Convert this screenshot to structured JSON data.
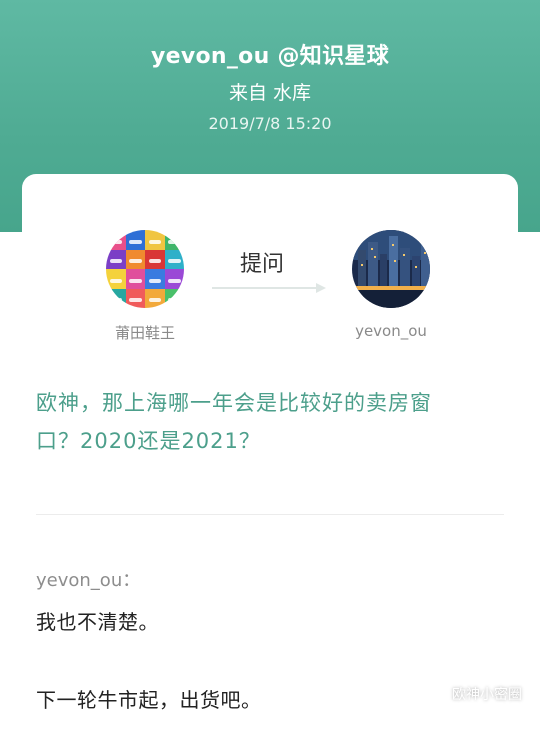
{
  "header": {
    "title": "yevon_ou @知识星球",
    "source": "来自 水库",
    "timestamp": "2019/7/8 15:20"
  },
  "card": {
    "asker": {
      "name": "莆田鞋王"
    },
    "responder": {
      "name": "yevon_ou"
    },
    "action_label": "提问",
    "question_line1": "欧神，那上海哪一年会是比较好的卖房窗",
    "question_line2": "口？2020还是2021？",
    "answer_label": "yevon_ou：",
    "answer_line1": "我也不清楚。",
    "answer_line2": "下一轮牛市起，出货吧。"
  },
  "watermark": {
    "text": "欧神小密圈",
    "icon": "wechat-icon"
  },
  "colors": {
    "header": "#4fab93",
    "question": "#4c9f8b"
  }
}
